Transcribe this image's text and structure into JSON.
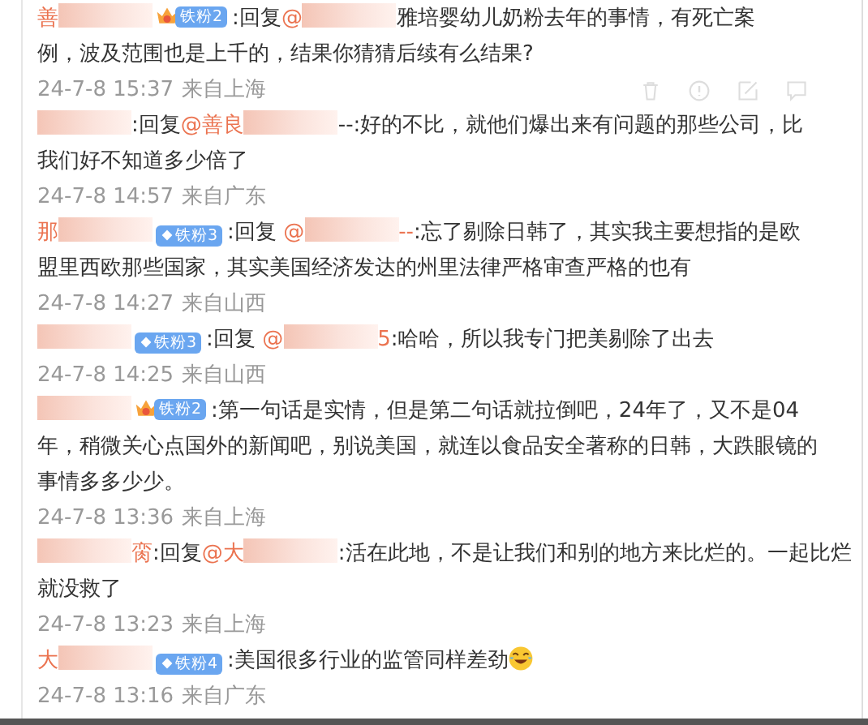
{
  "comments": [
    {
      "show_actions": true,
      "segments": [
        {
          "kind": "name",
          "text": "善"
        },
        {
          "kind": "blur"
        },
        {
          "kind": "crown_badge",
          "label": "铁粉2"
        },
        {
          "kind": "text",
          "text": ":回复"
        },
        {
          "kind": "mention",
          "text": "@"
        },
        {
          "kind": "blur"
        },
        {
          "kind": "text",
          "text": "雅培婴幼儿奶粉去年的事情，有死亡案",
          "more": "例，波及范围也是上千的，结果你猜猜后续有么结果?"
        }
      ],
      "time": "24-7-8 15:37",
      "location": "来自上海"
    },
    {
      "show_actions": false,
      "segments": [
        {
          "kind": "blur"
        },
        {
          "kind": "text",
          "text": ":回复"
        },
        {
          "kind": "mention",
          "text": "@善良"
        },
        {
          "kind": "blur"
        },
        {
          "kind": "text",
          "text": "--:好的不比，就他们爆出来有问题的那些公司，比",
          "more": "我们好不知道多少倍了"
        }
      ],
      "time": "24-7-8 14:57",
      "location": "来自广东"
    },
    {
      "show_actions": false,
      "segments": [
        {
          "kind": "name",
          "text": "那"
        },
        {
          "kind": "blur"
        },
        {
          "kind": "badge",
          "label": "铁粉3"
        },
        {
          "kind": "text",
          "text": ":回复 "
        },
        {
          "kind": "mention",
          "text": "@"
        },
        {
          "kind": "blur"
        },
        {
          "kind": "mention",
          "text": "--"
        },
        {
          "kind": "text",
          "text": ":忘了剔除日韩了，其实我主要想指的是欧",
          "more": "盟里西欧那些国家，其实美国经济发达的州里法律严格审查严格的也有"
        }
      ],
      "time": "24-7-8 14:27",
      "location": "来自山西"
    },
    {
      "show_actions": false,
      "segments": [
        {
          "kind": "blur"
        },
        {
          "kind": "badge",
          "label": "铁粉3"
        },
        {
          "kind": "text",
          "text": ":回复 "
        },
        {
          "kind": "mention",
          "text": "@"
        },
        {
          "kind": "blur"
        },
        {
          "kind": "mention",
          "text": "5"
        },
        {
          "kind": "text",
          "text": ":哈哈，所以我专门把美剔除了出去"
        }
      ],
      "time": "24-7-8 14:25",
      "location": "来自山西"
    },
    {
      "show_actions": false,
      "segments": [
        {
          "kind": "blur"
        },
        {
          "kind": "crown_badge",
          "label": "铁粉2"
        },
        {
          "kind": "text",
          "text": ":第一句话是实情，但是第二句话就拉倒吧，24年了，又不是04",
          "more": "年，稍微关心点国外的新闻吧，别说美国，就连以食品安全著称的日韩，大跌眼镜的事情多多少少。"
        }
      ],
      "time": "24-7-8 13:36",
      "location": "来自上海"
    },
    {
      "show_actions": false,
      "segments": [
        {
          "kind": "blur"
        },
        {
          "kind": "name",
          "text": "脔"
        },
        {
          "kind": "text",
          "text": ":回复"
        },
        {
          "kind": "mention",
          "text": "@大"
        },
        {
          "kind": "blur"
        },
        {
          "kind": "text",
          "text": ":活在此地，不是让我们和别的地方来比烂的。一起比烂",
          "more": "就没救了"
        }
      ],
      "time": "24-7-8 13:23",
      "location": "来自上海"
    },
    {
      "show_actions": false,
      "segments": [
        {
          "kind": "name",
          "text": "大"
        },
        {
          "kind": "blur"
        },
        {
          "kind": "badge",
          "label": "铁粉4"
        },
        {
          "kind": "text",
          "text": ":美国很多行业的监管同样差劲"
        },
        {
          "kind": "laugh_emoji"
        }
      ],
      "time": "24-7-8 13:16",
      "location": "来自广东"
    }
  ]
}
